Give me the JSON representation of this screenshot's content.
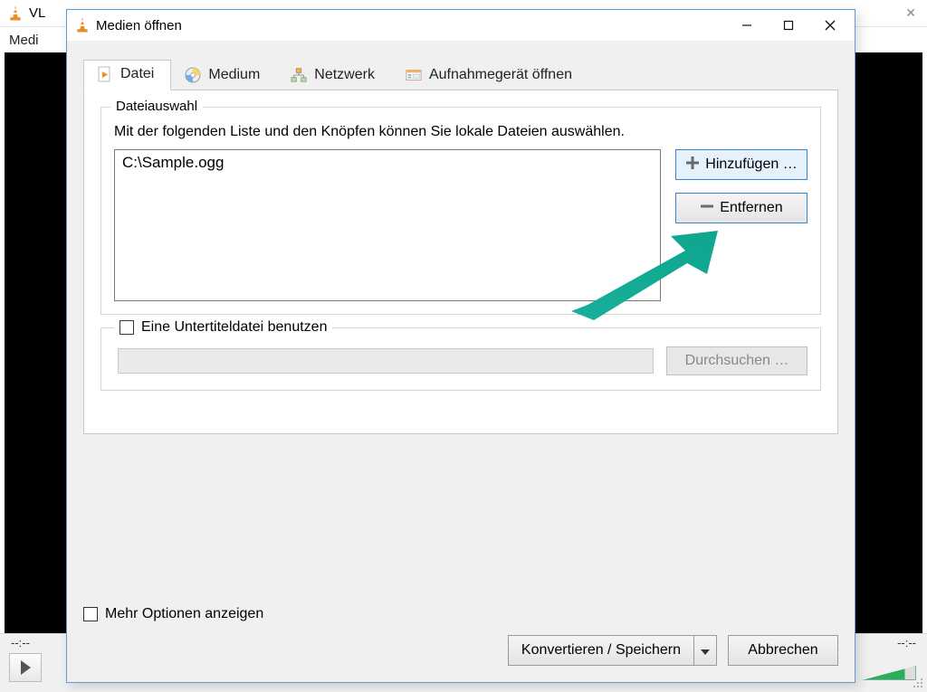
{
  "main_window": {
    "title_fragment": "VL",
    "menubar_fragment": "Medi",
    "time_left": "--:--",
    "time_right": "--:--"
  },
  "dialog": {
    "title": "Medien öffnen",
    "tabs": {
      "file": "Datei",
      "disc": "Medium",
      "network": "Netzwerk",
      "capture": "Aufnahmegerät öffnen"
    },
    "file_group": {
      "legend": "Dateiauswahl",
      "instruction": "Mit der folgenden Liste und den Knöpfen können Sie lokale Dateien auswählen.",
      "files": [
        "C:\\Sample.ogg"
      ],
      "add": "Hinzufügen …",
      "remove": "Entfernen"
    },
    "subtitle": {
      "checkbox": "Eine Untertiteldatei benutzen",
      "browse": "Durchsuchen …"
    },
    "more_options": "Mehr Optionen anzeigen",
    "convert_save": "Konvertieren / Speichern",
    "cancel": "Abbrechen"
  },
  "annotation": {
    "arrow_color": "#17b09a"
  }
}
